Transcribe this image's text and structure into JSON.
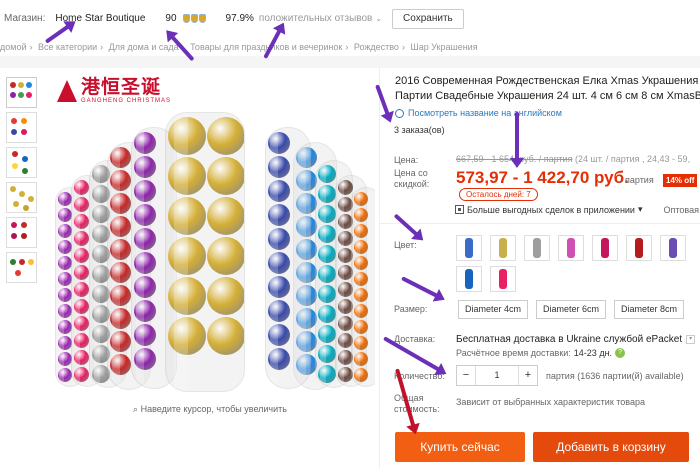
{
  "store_bar": {
    "store_label": "Магазин:",
    "store_name": "Home Star Boutique",
    "score": "90",
    "positive_pct": "97.9%",
    "positive_reviews_label": "положительных отзывов",
    "save_button": "Сохранить"
  },
  "breadcrumb": {
    "items": [
      "домой",
      "Все категории",
      "Для дома и сада",
      "Товары для праздников и вечеринок",
      "Рождество",
      "Шар Украшения"
    ],
    "separator": "›"
  },
  "gallery": {
    "brand_cn": "港恒圣诞",
    "brand_en": "GANGHENG CHRISTMAS",
    "zoom_hint": "Наведите курсор, чтобы увеличить"
  },
  "product": {
    "title_line1": "2016 Современная Рождественская Елка Xmas Украшения Ш",
    "title_line2": "Партии Свадебные Украшения 24 шт. 4 см 6 см 8 см XmasB",
    "translate_link": "Посмотреть название на английском",
    "orders": "3 заказа(ов)"
  },
  "pricing": {
    "price_label": "Цена:",
    "old_price": "667,59 - 1 654,",
    "old_price_tail": "руб. / партия",
    "old_price_extra": "(24 шт. / партия , 24,43 - 59,",
    "discount_label_l1": "Цена со",
    "discount_label_l2": "скидкой:",
    "new_price": "573,97 - 1 422,70 руб.",
    "per_unit": "/ партия",
    "discount_badge": "14% off",
    "days_left": "Осталось дней: 7",
    "app_deals": "Больше выгодных сделок в приложении",
    "wholesale": "Оптовая"
  },
  "options": {
    "color_label": "Цвет:",
    "colors": [
      "#3a6bc9",
      "#c8b04a",
      "#9e9e9e",
      "#d04fb5",
      "#c2185b",
      "#b71c1c",
      "#6a4fb3",
      "#1565c0",
      "#e91e63"
    ],
    "size_label": "Размер:",
    "sizes": [
      "Diameter 4cm",
      "Diameter 6cm",
      "Diameter 8cm"
    ]
  },
  "shipping": {
    "label": "Доставка:",
    "text": "Бесплатная доставка в Ukraine службой ePacket",
    "eta_label": "Расчётное время доставки:",
    "eta_value": "14-23 дн."
  },
  "quantity": {
    "label": "Количество:",
    "value": "1",
    "available": "партия (1636 партии(й) available)",
    "minus": "−",
    "plus": "+"
  },
  "total": {
    "label_l1": "Общая",
    "label_l2": "стоимость:",
    "value": "Зависит от выбранных характеристик товара"
  },
  "actions": {
    "buy_now": "Купить сейчас",
    "add_to_cart": "Добавить в корзину"
  },
  "colors": {
    "price_red": "#e62e04",
    "buy_orange": "#f25f13",
    "cart_orange": "#e44a0c",
    "annotation_purple": "#6b2fb8",
    "annotation_red": "#c2122b"
  }
}
